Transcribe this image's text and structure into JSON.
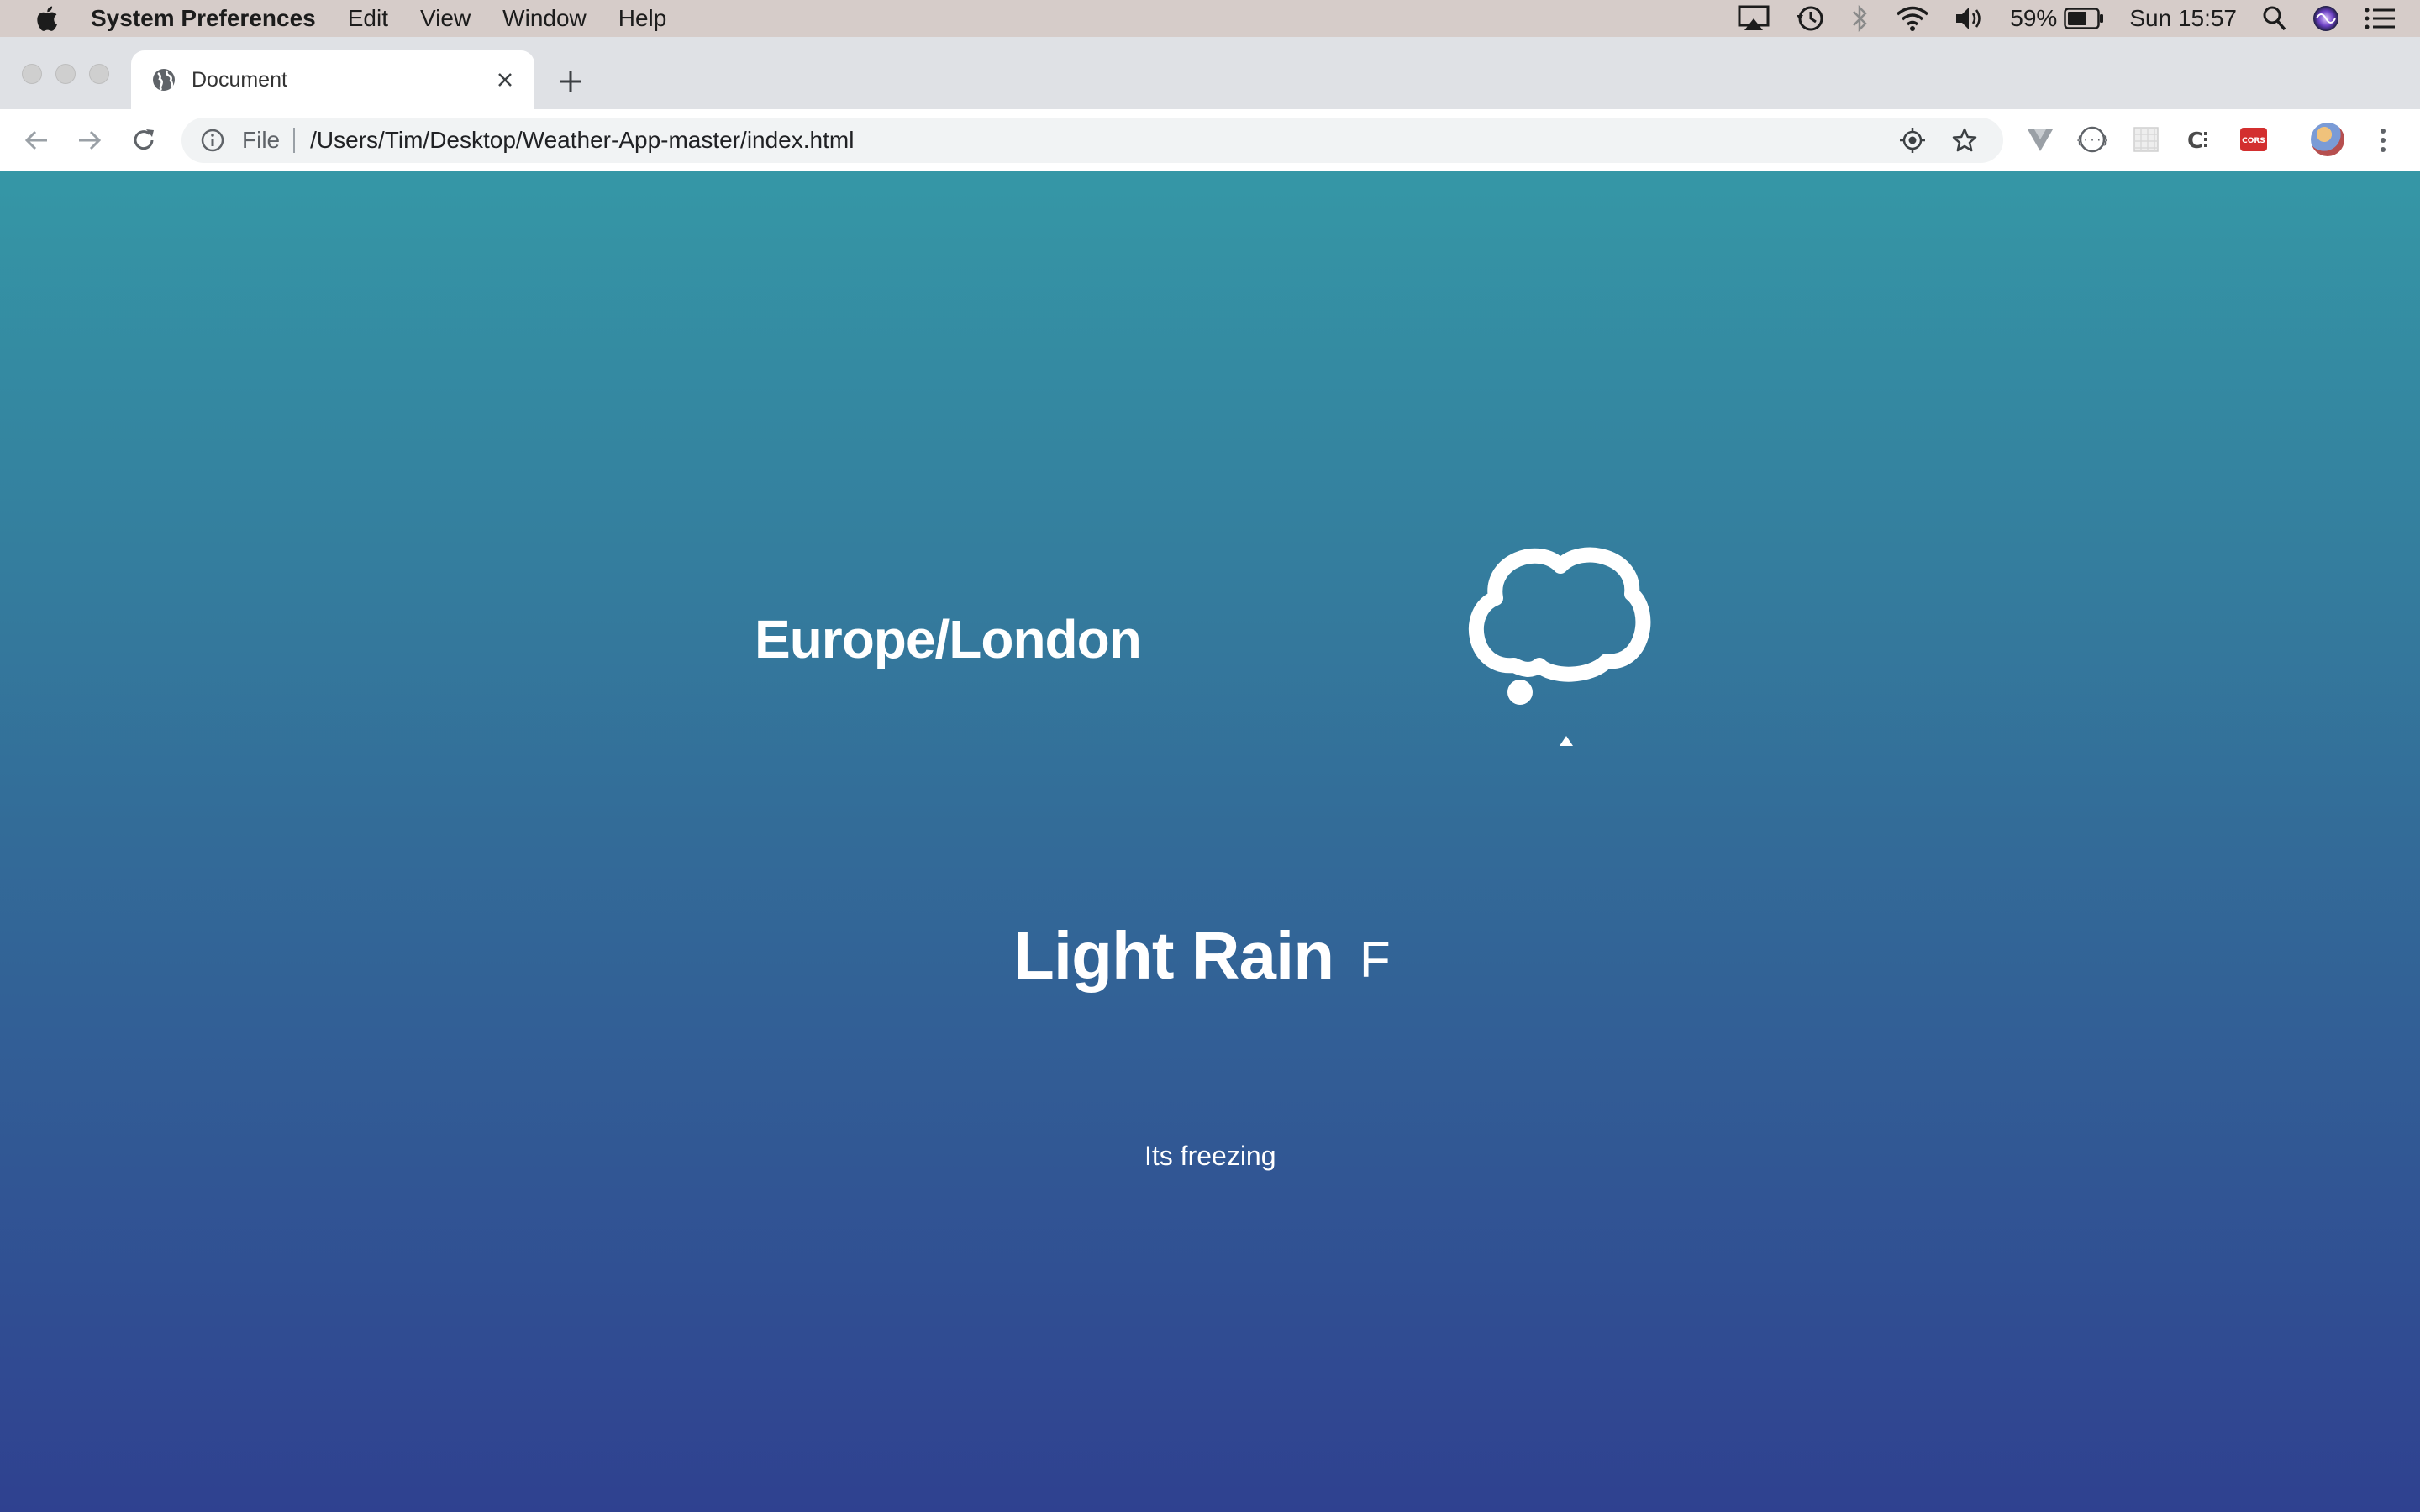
{
  "menubar": {
    "app_name": "System Preferences",
    "items": [
      "Edit",
      "View",
      "Window",
      "Help"
    ],
    "battery_percent": "59%",
    "clock": "Sun 15:57"
  },
  "browser": {
    "tab_title": "Document",
    "omnibox": {
      "scheme_label": "File",
      "url": "/Users/Tim/Desktop/Weather-App-master/index.html"
    }
  },
  "weather": {
    "location": "Europe/London",
    "icon": "cloud-icon",
    "description": "Light Rain",
    "unit": "F",
    "message": "Its freezing"
  },
  "colors": {
    "gradient_top": "#3597a6",
    "gradient_bottom": "#2f4190",
    "text": "#ffffff"
  }
}
